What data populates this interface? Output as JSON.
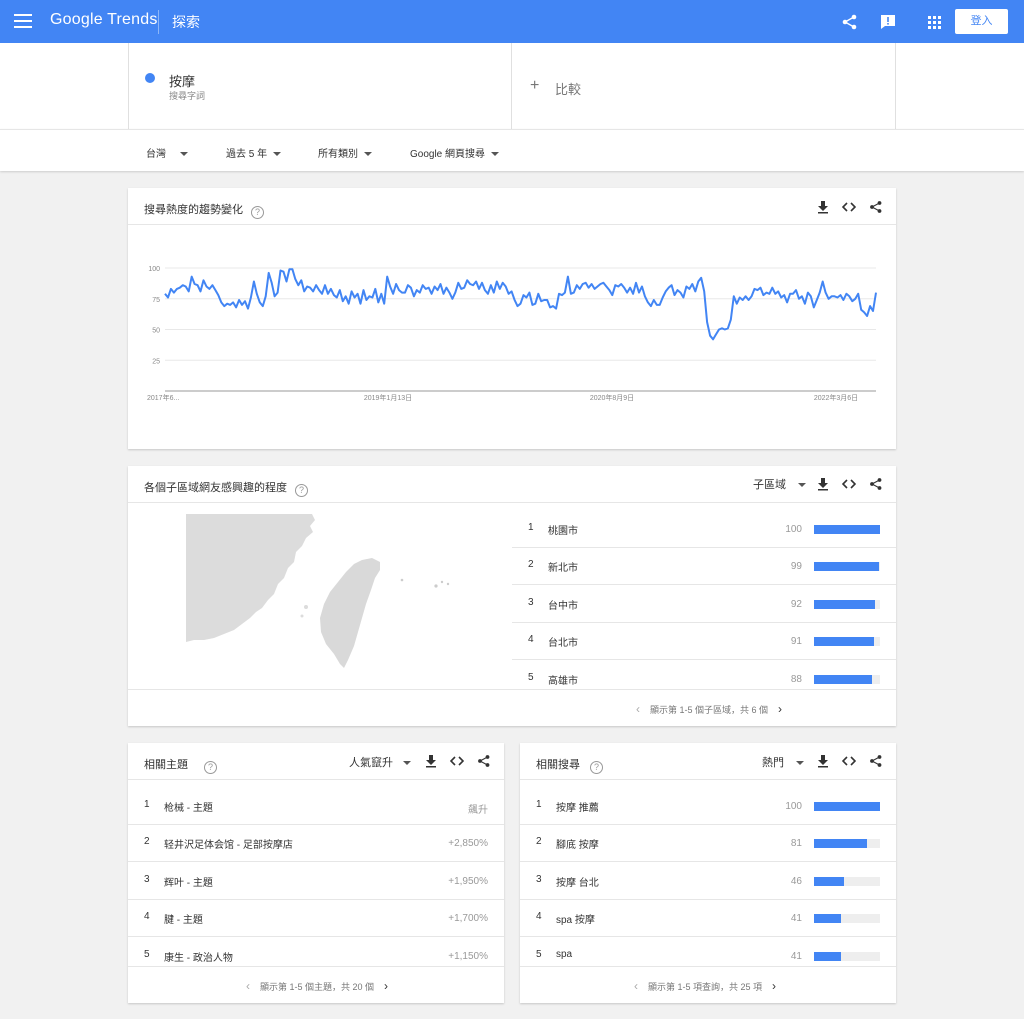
{
  "header": {
    "logo": "Google Trends",
    "explore": "探索",
    "signin": "登入"
  },
  "term": {
    "name": "按摩",
    "sub": "搜尋字詞",
    "color": "#4285f4"
  },
  "compare": {
    "plus": "+",
    "label": "比較"
  },
  "filters": [
    "台灣",
    "過去 5 年",
    "所有類別",
    "Google 網頁搜尋"
  ],
  "trend_card": {
    "title": "搜尋熱度的趨勢變化",
    "help": "?",
    "chart_data": {
      "type": "line",
      "series": [
        {
          "values": [
            79,
            76,
            83,
            80,
            83,
            84,
            86,
            85,
            81,
            93,
            87,
            86,
            81,
            90,
            85,
            83,
            86,
            82,
            78,
            72,
            69,
            71,
            70,
            72,
            68,
            74,
            70,
            73,
            67,
            76,
            89,
            79,
            72,
            69,
            77,
            96,
            88,
            77,
            80,
            98,
            97,
            89,
            99,
            99,
            91,
            86,
            90,
            81,
            85,
            84,
            81,
            86,
            82,
            79,
            86,
            79,
            83,
            78,
            76,
            82,
            73,
            77,
            71,
            81,
            76,
            79,
            71,
            82,
            74,
            77,
            76,
            83,
            72,
            79,
            71,
            93,
            85,
            79,
            87,
            82,
            80,
            80,
            86,
            84,
            77,
            82,
            80,
            86,
            83,
            84,
            79,
            85,
            82,
            87,
            79,
            84,
            80,
            75,
            80,
            88,
            83,
            84,
            90,
            87,
            86,
            89,
            83,
            88,
            82,
            79,
            86,
            80,
            89,
            83,
            88,
            85,
            79,
            81,
            74,
            69,
            71,
            78,
            76,
            80,
            70,
            71,
            79,
            73,
            74,
            74,
            68,
            69,
            67,
            79,
            78,
            80,
            93,
            79,
            80,
            86,
            83,
            87,
            88,
            84,
            87,
            83,
            85,
            87,
            88,
            85,
            82,
            78,
            86,
            85,
            87,
            84,
            80,
            84,
            79,
            88,
            80,
            85,
            77,
            72,
            69,
            74,
            70,
            70,
            76,
            81,
            84,
            86,
            78,
            82,
            80,
            76,
            85,
            83,
            87,
            81,
            89,
            92,
            81,
            56,
            45,
            42,
            46,
            50,
            51,
            50,
            51,
            58,
            77,
            71,
            76,
            74,
            77,
            74,
            77,
            83,
            82,
            84,
            78,
            80,
            79,
            84,
            79,
            81,
            76,
            78,
            72,
            79,
            79,
            82,
            75,
            77,
            71,
            80,
            77,
            68,
            74,
            80,
            89,
            80,
            75,
            77,
            77,
            76,
            78,
            74,
            79,
            77,
            73,
            75,
            79,
            66,
            64,
            61,
            69,
            65,
            80
          ]
        }
      ],
      "x_tick_labels": [
        "2017年6...",
        "2019年1月13日",
        "2020年8月9日",
        "2022年3月6日"
      ],
      "y_tick_labels": [
        "100",
        "75",
        "50",
        "25"
      ],
      "ylim": [
        0,
        100
      ],
      "grid": true,
      "color": "#4285f4"
    }
  },
  "region_card": {
    "title": "各個子區域網友感興趣的程度",
    "help": "?",
    "select": "子區域",
    "rows": [
      {
        "rank": "1",
        "name": "桃園市",
        "value": "100",
        "pct": 100
      },
      {
        "rank": "2",
        "name": "新北市",
        "value": "99",
        "pct": 99
      },
      {
        "rank": "3",
        "name": "台中市",
        "value": "92",
        "pct": 92
      },
      {
        "rank": "4",
        "name": "台北市",
        "value": "91",
        "pct": 91
      },
      {
        "rank": "5",
        "name": "高雄市",
        "value": "88",
        "pct": 88
      }
    ],
    "pager": "顯示第 1-5 個子區域，共 6 個"
  },
  "topics_card": {
    "title": "相關主題",
    "help": "?",
    "select": "人氣竄升",
    "rows": [
      {
        "rank": "1",
        "name": "枪械 - 主題",
        "value": "飆升"
      },
      {
        "rank": "2",
        "name": "轻井沢足体会馆 - 足部按摩店",
        "value": "+2,850%"
      },
      {
        "rank": "3",
        "name": "辉叶 - 主題",
        "value": "+1,950%"
      },
      {
        "rank": "4",
        "name": "腱 - 主題",
        "value": "+1,700%"
      },
      {
        "rank": "5",
        "name": "康生 - 政治人物",
        "value": "+1,150%"
      }
    ],
    "pager": "顯示第 1-5 個主題，共 20 個"
  },
  "queries_card": {
    "title": "相關搜尋",
    "help": "?",
    "select": "熱門",
    "rows": [
      {
        "rank": "1",
        "name": "按摩 推薦",
        "value": "100",
        "pct": 100
      },
      {
        "rank": "2",
        "name": "腳底 按摩",
        "value": "81",
        "pct": 81
      },
      {
        "rank": "3",
        "name": "按摩 台北",
        "value": "46",
        "pct": 46
      },
      {
        "rank": "4",
        "name": "spa 按摩",
        "value": "41",
        "pct": 41
      },
      {
        "rank": "5",
        "name": "spa",
        "value": "41",
        "pct": 41
      }
    ],
    "pager": "顯示第 1-5 項查詢，共 25 項"
  }
}
